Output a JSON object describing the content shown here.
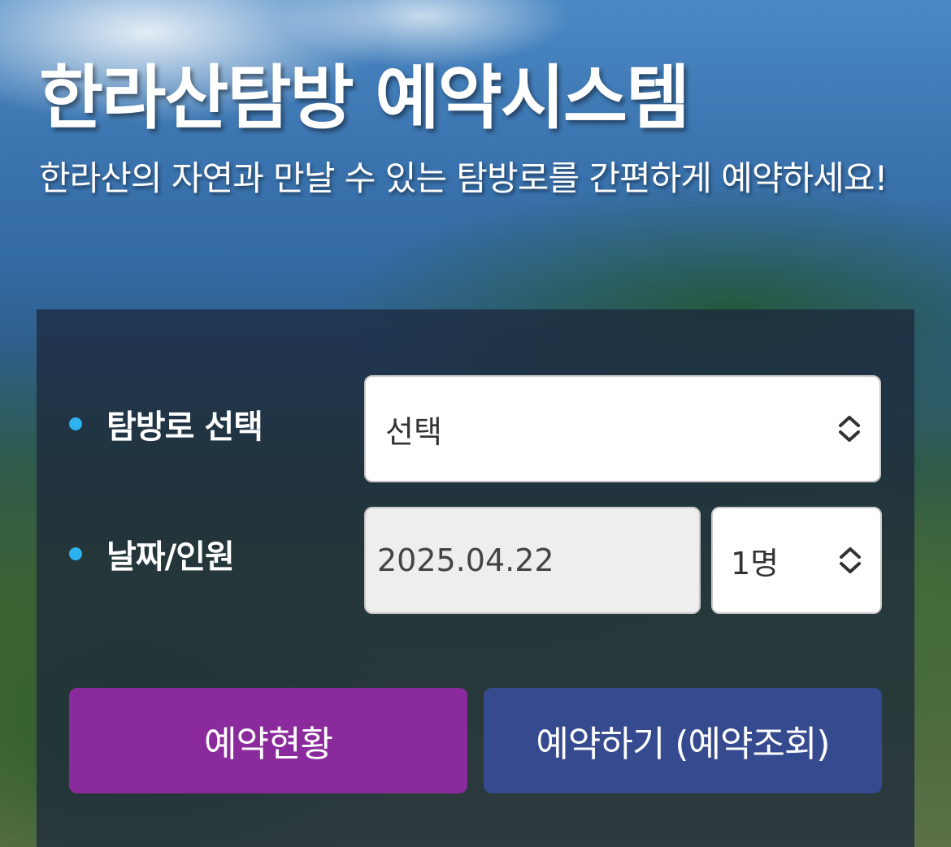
{
  "header": {
    "title": "한라산탐방 예약시스템",
    "subtitle": "한라산의 자연과 만날 수 있는 탐방로를 간편하게 예약하세요!"
  },
  "form": {
    "trail": {
      "label": "탐방로 선택",
      "selected": "선택",
      "icon": "updown-chevron-icon"
    },
    "date_people": {
      "label": "날짜/인원",
      "date_value": "2025.04.22",
      "people_selected": "1명",
      "icon": "updown-chevron-icon"
    }
  },
  "buttons": {
    "status_label": "예약현황",
    "reserve_label": "예약하기 (예약조회)"
  },
  "colors": {
    "bullet": "#2db2f0",
    "status_button": "#8b2a9c",
    "reserve_button": "#364a8f"
  }
}
